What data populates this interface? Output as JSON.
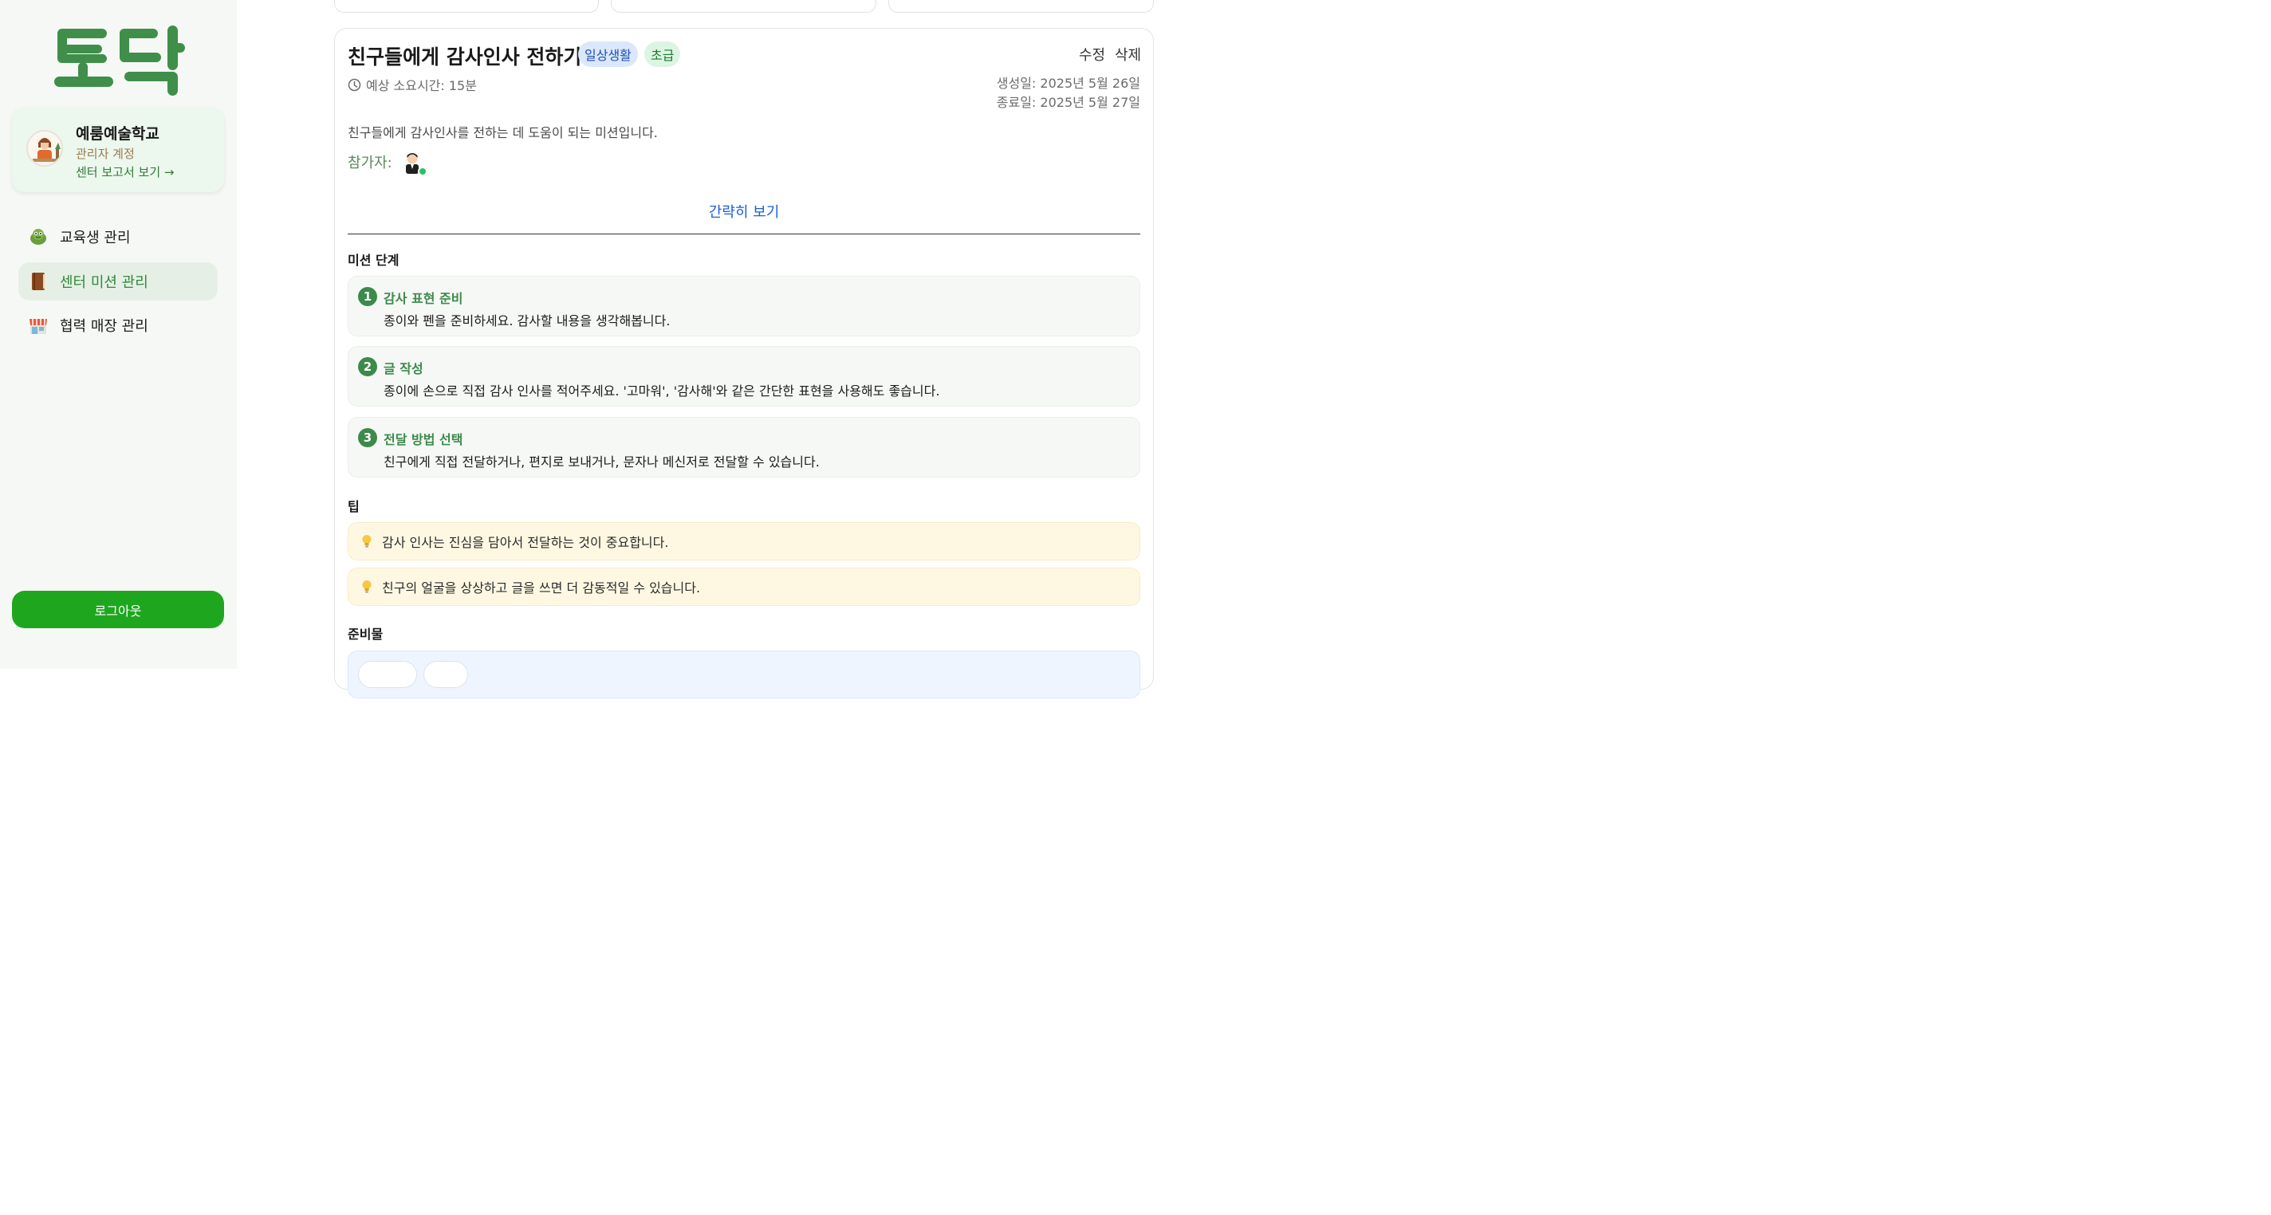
{
  "sidebar": {
    "logo_text": "토닥",
    "profile": {
      "school_name": "예룸예술학교",
      "role": "관리자 계정",
      "report_link": "센터 보고서 보기 →"
    },
    "nav": [
      {
        "label": "교육생 관리",
        "icon": "turtle-icon",
        "active": false
      },
      {
        "label": "센터 미션 관리",
        "icon": "book-icon",
        "active": true
      },
      {
        "label": "협력 매장 관리",
        "icon": "store-icon",
        "active": false
      }
    ],
    "logout_label": "로그아웃"
  },
  "mission": {
    "title": "친구들에게 감사인사 전하기",
    "category": "일상생활",
    "level": "초급",
    "edit_label": "수정",
    "delete_label": "삭제",
    "duration": "예상 소요시간: 15분",
    "created": "생성일: 2025년 5월 26일",
    "ended": "종료일: 2025년 5월 27일",
    "description": "친구들에게 감사인사를 전하는 데 도움이 되는 미션입니다.",
    "participants_label": "참가자:",
    "collapse_label": "간략히 보기",
    "steps_title": "미션 단계",
    "steps": [
      {
        "num": "1",
        "title": "감사 표현 준비",
        "desc": "종이와 펜을 준비하세요. 감사할 내용을 생각해봅니다."
      },
      {
        "num": "2",
        "title": "글 작성",
        "desc": "종이에 손으로 직접 감사 인사를 적어주세요. '고마워', '감사해'와 같은 간단한 표현을 사용해도 좋습니다."
      },
      {
        "num": "3",
        "title": "전달 방법 선택",
        "desc": "친구에게 직접 전달하거나, 편지로 보내거나, 문자나 메신저로 전달할 수 있습니다."
      }
    ],
    "tips_title": "팁",
    "tips": [
      "감사 인사는 진심을 담아서 전달하는 것이 중요합니다.",
      "친구의 얼굴을 상상하고 글을 쓰면 더 감동적일 수 있습니다."
    ],
    "materials_title": "준비물"
  },
  "colors": {
    "brand_green": "#3c8a4c",
    "logout_green": "#1ea71e",
    "link_blue": "#1a5fd8"
  }
}
